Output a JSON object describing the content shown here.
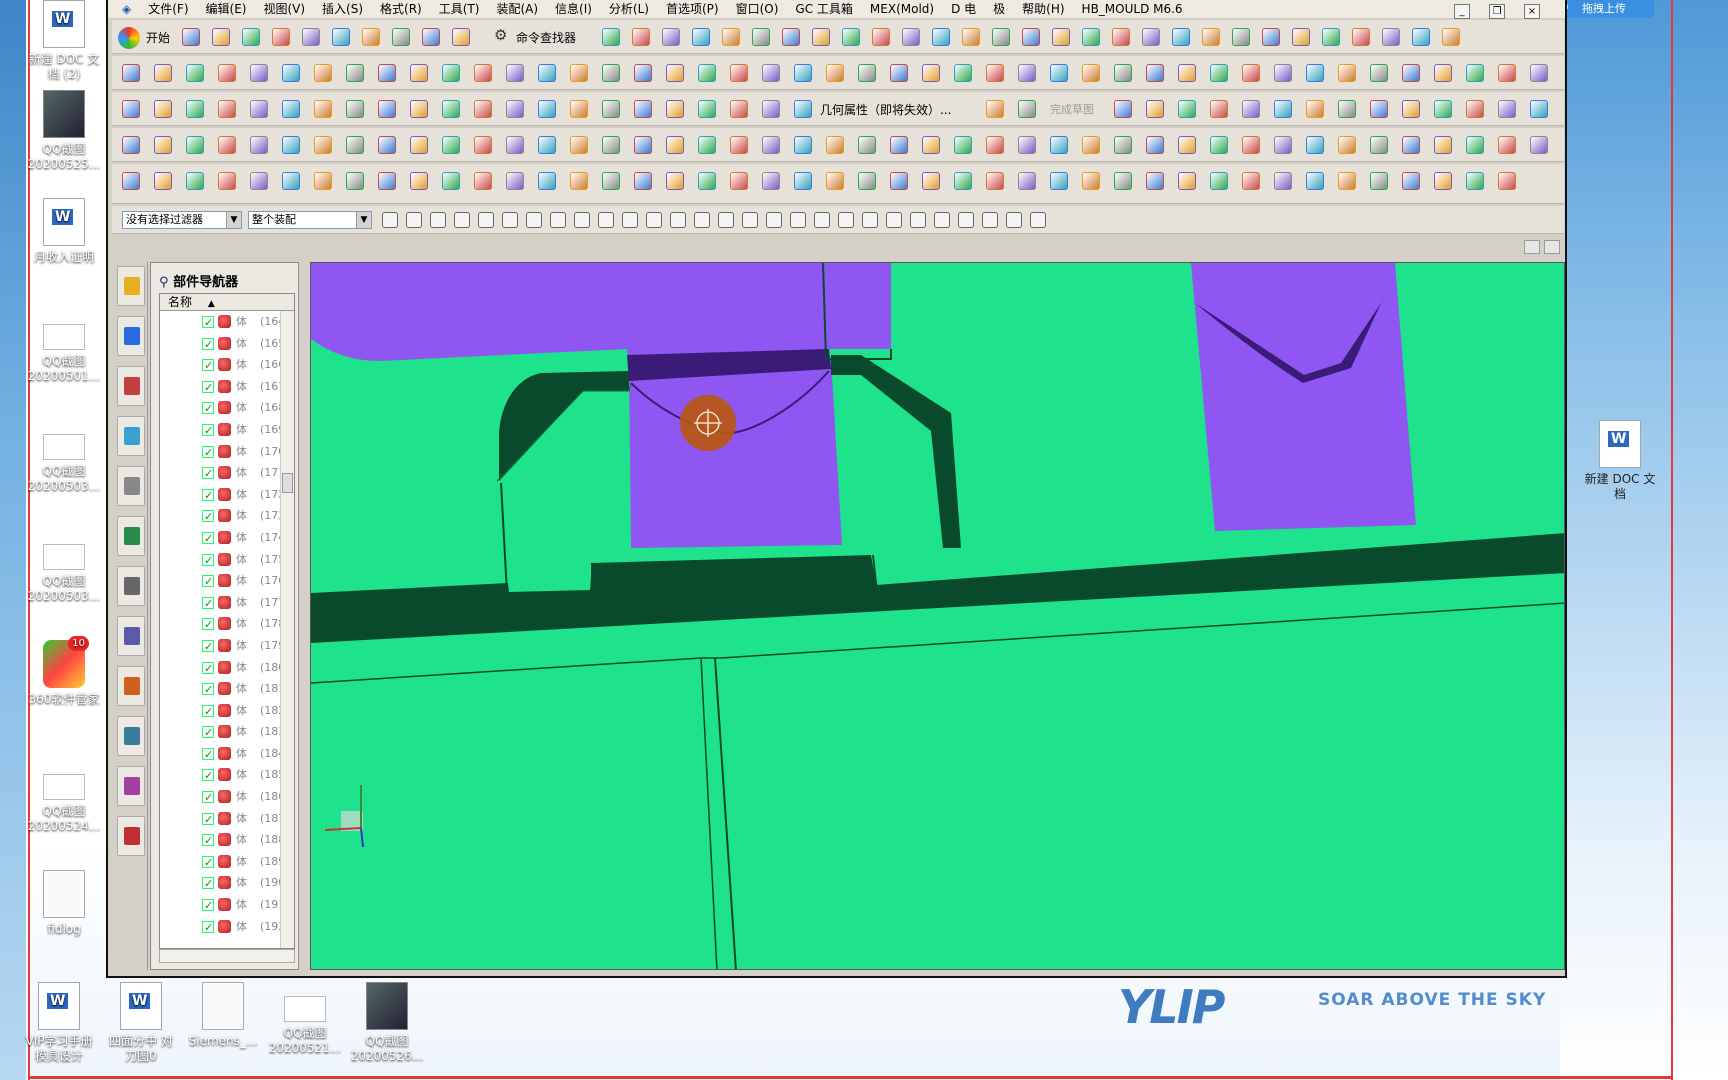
{
  "desktop": {
    "left_icons": [
      {
        "label": "新建 DOC 文\n档 (2)",
        "kind": "doc"
      },
      {
        "label": "QQ截图\n20200525...",
        "kind": "thumbimg"
      },
      {
        "label": "月收入证明",
        "kind": "doc"
      },
      {
        "label": "QQ截图\n20200501...",
        "kind": "thumb"
      },
      {
        "label": "QQ截图\n20200503...",
        "kind": "thumb"
      },
      {
        "label": "QQ截图\n20200503...",
        "kind": "thumb"
      },
      {
        "label": "360软件管家",
        "kind": "s360",
        "badge": "10"
      },
      {
        "label": "QQ截图\n20200524...",
        "kind": "thumb"
      },
      {
        "label": "fidlog",
        "kind": "plain"
      }
    ],
    "bottom_icons": [
      {
        "label": "VIP学习手册\n模具设计",
        "kind": "doc"
      },
      {
        "label": "四面分中 对\n刀图0",
        "kind": "doc"
      },
      {
        "label": "Siemens_...",
        "kind": "plain"
      },
      {
        "label": "QQ截图\n20200521...",
        "kind": "thumb"
      },
      {
        "label": "QQ截图\n20200526...",
        "kind": "thumbimg"
      }
    ],
    "right_icon": {
      "label": "新建 DOC 文\n档",
      "kind": "doc"
    },
    "cloud_button": "拖拽上传",
    "watermark_sub": "SOAR ABOVE THE SKY"
  },
  "menu": [
    "文件(F)",
    "编辑(E)",
    "视图(V)",
    "插入(S)",
    "格式(R)",
    "工具(T)",
    "装配(A)",
    "信息(I)",
    "分析(L)",
    "首选项(P)",
    "窗口(O)",
    "GC 工具箱",
    "MEX(Mold)",
    "D 电",
    "极",
    "帮助(H)",
    "HB_MOULD M6.6"
  ],
  "toolbar": {
    "start_label": "开始",
    "command_finder": "命令查找器",
    "geom_prop": "几何属性（即将失效）...",
    "finish_sketch": "完成草图"
  },
  "filter": {
    "type_filter": "没有选择过滤器",
    "scope": "整个装配"
  },
  "navigator": {
    "title": "部件导航器",
    "column": "名称",
    "rows": [
      {
        "type": "体",
        "id": "(164"
      },
      {
        "type": "体",
        "id": "(165"
      },
      {
        "type": "体",
        "id": "(166"
      },
      {
        "type": "体",
        "id": "(167"
      },
      {
        "type": "体",
        "id": "(168"
      },
      {
        "type": "体",
        "id": "(169"
      },
      {
        "type": "体",
        "id": "(170"
      },
      {
        "type": "体",
        "id": "(171"
      },
      {
        "type": "体",
        "id": "(172"
      },
      {
        "type": "体",
        "id": "(173"
      },
      {
        "type": "体",
        "id": "(174"
      },
      {
        "type": "体",
        "id": "(175"
      },
      {
        "type": "体",
        "id": "(176"
      },
      {
        "type": "体",
        "id": "(177"
      },
      {
        "type": "体",
        "id": "(178"
      },
      {
        "type": "体",
        "id": "(179"
      },
      {
        "type": "体",
        "id": "(180"
      },
      {
        "type": "体",
        "id": "(181"
      },
      {
        "type": "体",
        "id": "(182"
      },
      {
        "type": "体",
        "id": "(183"
      },
      {
        "type": "体",
        "id": "(184"
      },
      {
        "type": "体",
        "id": "(185"
      },
      {
        "type": "体",
        "id": "(186"
      },
      {
        "type": "体",
        "id": "(187"
      },
      {
        "type": "体",
        "id": "(188"
      },
      {
        "type": "体",
        "id": "(189"
      },
      {
        "type": "体",
        "id": "(190"
      },
      {
        "type": "体",
        "id": "(191"
      },
      {
        "type": "体",
        "id": "(192"
      }
    ]
  },
  "colors": {
    "face_green": "#1ee38c",
    "face_purple": "#8f56f2",
    "wall_dark": "#0a4a2c",
    "cursor": "#b9580d"
  },
  "icons": [
    "undo-icon",
    "redo-icon",
    "open-icon",
    "save-icon",
    "new-icon",
    "cut-icon",
    "copy-icon",
    "paste-icon",
    "point-icon",
    "line-icon",
    "arc-icon",
    "circle-icon",
    "rectangle-icon",
    "text-icon",
    "block-icon",
    "cylinder-icon",
    "cone-icon",
    "sphere-icon",
    "coordinate-system-icon",
    "cursor-crosshair-icon"
  ]
}
